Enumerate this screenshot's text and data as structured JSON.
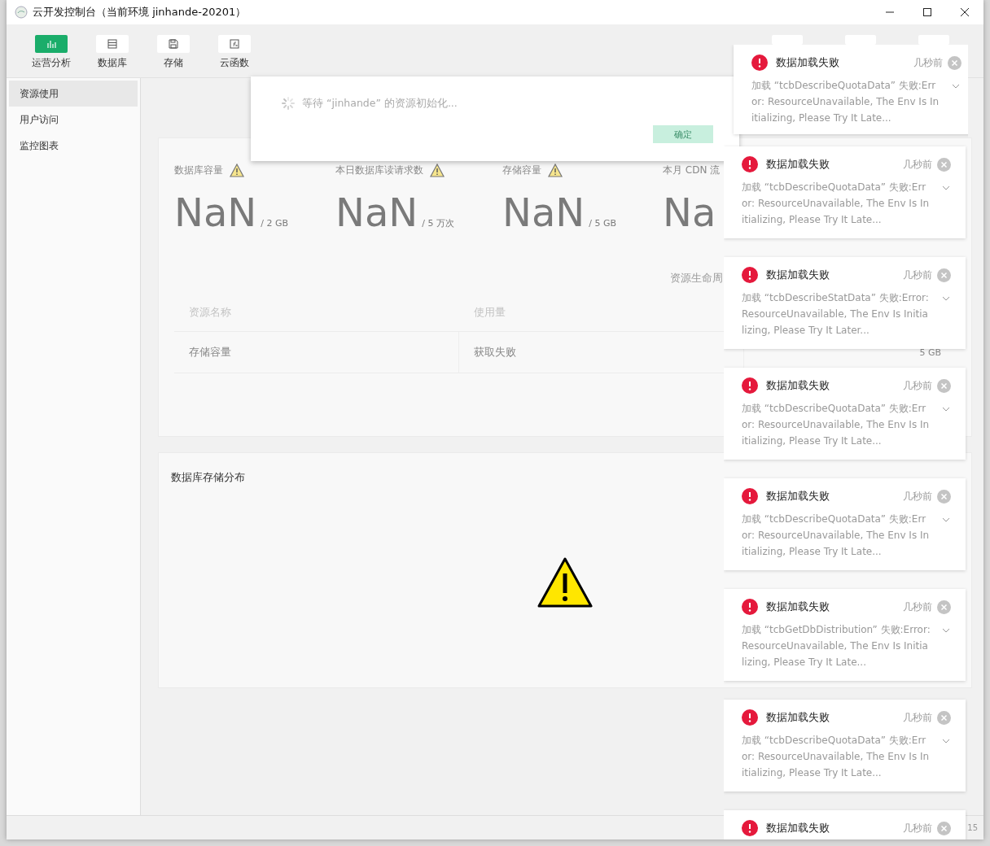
{
  "window": {
    "title": "云开发控制台（当前环境 jinhande-20201）"
  },
  "toolbar": [
    {
      "label": "运营分析",
      "selected": true
    },
    {
      "label": "数据库",
      "selected": false
    },
    {
      "label": "存储",
      "selected": false
    },
    {
      "label": "云函数",
      "selected": false
    }
  ],
  "sidebar": {
    "items": [
      {
        "label": "资源使用",
        "selected": true
      },
      {
        "label": "用户访问",
        "selected": false
      },
      {
        "label": "监控图表",
        "selected": false
      }
    ]
  },
  "stats": [
    {
      "label": "数据库容量",
      "value": "NaN",
      "unit": "/ 2 GB",
      "warning": true
    },
    {
      "label": "本日数据库读请求数",
      "value": "NaN",
      "unit": "/ 5 万次",
      "warning": true
    },
    {
      "label": "存储容量",
      "value": "NaN",
      "unit": "/ 5 GB",
      "warning": true
    },
    {
      "label": "本月 CDN 流",
      "value": "Na"
    }
  ],
  "lifecycle_label": "资源生命周",
  "table": {
    "columns": [
      "资源名称",
      "使用量"
    ],
    "rows": [
      [
        "存储容量",
        "获取失败",
        "5 GB"
      ]
    ]
  },
  "distribution": {
    "title": "数据库存储分布"
  },
  "status_bar": {
    "text": "15"
  },
  "dialog": {
    "message": "等待 “jinhande” 的资源初始化...",
    "button": "确定",
    "button_disabled": true
  },
  "notifications": [
    {
      "title": "数据加载失败",
      "time": "几秒前",
      "message": "加载 “tcbDescribeQuotaData” 失败:Error: ResourceUnavailable, The Env Is Initializing, Please Try It Late..."
    },
    {
      "title": "数据加载失败",
      "time": "几秒前",
      "message": "加载 “tcbDescribeQuotaData” 失败:Error: ResourceUnavailable, The Env Is Initializing, Please Try It Late..."
    },
    {
      "title": "数据加载失败",
      "time": "几秒前",
      "message": "加载 “tcbDescribeStatData” 失败:Error: ResourceUnavailable, The Env Is Initializing, Please Try It Later..."
    },
    {
      "title": "数据加载失败",
      "time": "几秒前",
      "message": "加载 “tcbDescribeQuotaData” 失败:Error: ResourceUnavailable, The Env Is Initializing, Please Try It Late..."
    },
    {
      "title": "数据加载失败",
      "time": "几秒前",
      "message": "加载 “tcbDescribeQuotaData” 失败:Error: ResourceUnavailable, The Env Is Initializing, Please Try It Late..."
    },
    {
      "title": "数据加载失败",
      "time": "几秒前",
      "message": "加载 “tcbGetDbDistribution” 失败:Error: ResourceUnavailable, The Env Is Initializing, Please Try It Late..."
    },
    {
      "title": "数据加载失败",
      "time": "几秒前",
      "message": "加载 “tcbDescribeQuotaData” 失败:Error: ResourceUnavailable, The Env Is Initializing, Please Try It Late..."
    },
    {
      "title": "数据加载失败",
      "time": "几秒前"
    }
  ]
}
